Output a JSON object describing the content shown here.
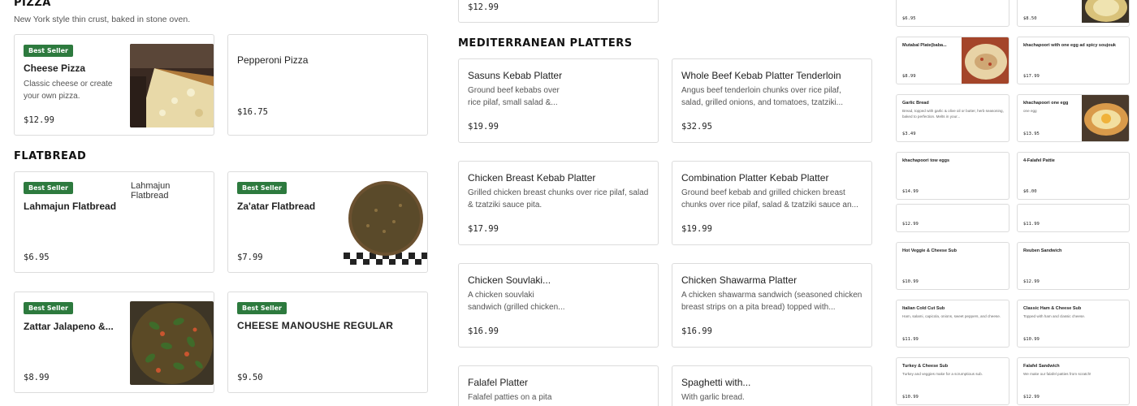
{
  "pizza": {
    "title": "PIZZA",
    "subtitle": "New York style thin crust, baked in stone oven.",
    "items": [
      {
        "badge": "Best Seller",
        "name": "Cheese Pizza",
        "desc": "Classic cheese or create your own pizza.",
        "price": "$12.99"
      },
      {
        "name": "Pepperoni Pizza",
        "price": "$16.75"
      }
    ]
  },
  "flatbread": {
    "title": "FLATBREAD",
    "items": [
      {
        "badge": "Best Seller",
        "name": "Lahmajun Flatbread",
        "img_alt": "Lahmajun Flatbread",
        "price": "$6.95"
      },
      {
        "badge": "Best Seller",
        "name": "Za'atar Flatbread",
        "price": "$7.99"
      },
      {
        "badge": "Best Seller",
        "name": "Zattar Jalapeno &...",
        "price": "$8.99"
      },
      {
        "badge": "Best Seller",
        "name": "CHEESE MANOUSHE REGULAR",
        "price": "$9.50"
      }
    ]
  },
  "top_middle_card": {
    "price": "$12.99"
  },
  "mediterranean": {
    "title": "MEDITERRANEAN PLATTERS",
    "items": [
      {
        "name": "Sasuns Kebab Platter",
        "desc": "Ground beef kebabs over rice pilaf, small salad &...",
        "price": "$19.99"
      },
      {
        "name": "Whole Beef Kebab Platter Tenderloin",
        "desc": "Angus beef tenderloin chunks over rice pilaf, salad, grilled onions, and tomatoes, tzatziki...",
        "price": "$32.95"
      },
      {
        "name": "Chicken Breast Kebab Platter",
        "desc": "Grilled chicken breast chunks over rice pilaf, salad & tzatziki sauce pita.",
        "price": "$17.99"
      },
      {
        "name": "Combination Platter Kebab Platter",
        "desc": "Ground beef kebab and grilled chicken breast chunks over rice pilaf, salad & tzatziki sauce an...",
        "price": "$19.99"
      },
      {
        "name": "Chicken Souvlaki...",
        "desc": "A chicken souvlaki sandwich (grilled chicken...",
        "price": "$16.99"
      },
      {
        "name": "Chicken Shawarma Platter",
        "desc": "A chicken shawarma sandwich (seasoned chicken breast strips on a pita bread) topped with...",
        "price": "$16.99"
      },
      {
        "name": "Falafel Platter",
        "desc": "Falafel patties on a pita"
      },
      {
        "name": "Spaghetti with...",
        "desc": "With garlic bread."
      }
    ]
  },
  "right_grid": {
    "items": [
      {
        "name": "",
        "desc": "",
        "price": "$6.95"
      },
      {
        "name": "",
        "desc": "",
        "price": "$8.50"
      },
      {
        "name": "Mutabal Plate(baba...",
        "desc": "",
        "price": "$8.99"
      },
      {
        "name": "khachapoori with one egg ad spicy soujouk",
        "desc": "",
        "price": "$17.99"
      },
      {
        "name": "Garlic Bread",
        "desc": "Bread, topped with garlic & olive oil or butter, herb seasoning, baked to perfection. Melts in your...",
        "price": "$3.49"
      },
      {
        "name": "khachapoori one egg",
        "desc": "one egg",
        "price": "$13.95"
      },
      {
        "name": "khachapoori tow eggs",
        "desc": "",
        "price": "$14.99"
      },
      {
        "name": "4-Falafel Pattie",
        "desc": "",
        "price": "$6.00"
      },
      {
        "name": "",
        "desc": "",
        "price": "$12.99"
      },
      {
        "name": "",
        "desc": "",
        "price": "$11.99"
      },
      {
        "name": "Hot Veggie & Cheese Sub",
        "desc": "",
        "price": "$10.99"
      },
      {
        "name": "Reuben Sandwich",
        "desc": "",
        "price": "$12.99"
      },
      {
        "name": "Italian Cold Cut Sub",
        "desc": "Ham, salami, capicola, onions, sweet peppers, and cheese.",
        "price": "$11.99"
      },
      {
        "name": "Classic Ham & Cheese Sub",
        "desc": "Topped with ham and classic cheese.",
        "price": "$10.99"
      },
      {
        "name": "Turkey & Cheese Sub",
        "desc": "Turkey and veggies make for a scrumptious sub.",
        "price": "$10.99"
      },
      {
        "name": "Falafel Sandwich",
        "desc": "We make our falafel patties from scratch!",
        "price": "$12.99"
      }
    ]
  },
  "colors": {
    "badge": "#2d7a3e",
    "border": "#dcdcdc"
  },
  "icons": [
    "pizza-photo",
    "zaatar-photo",
    "zattar-jalapeno-photo",
    "mutabal-photo",
    "khachapoori-photo",
    "bowl-photo"
  ]
}
